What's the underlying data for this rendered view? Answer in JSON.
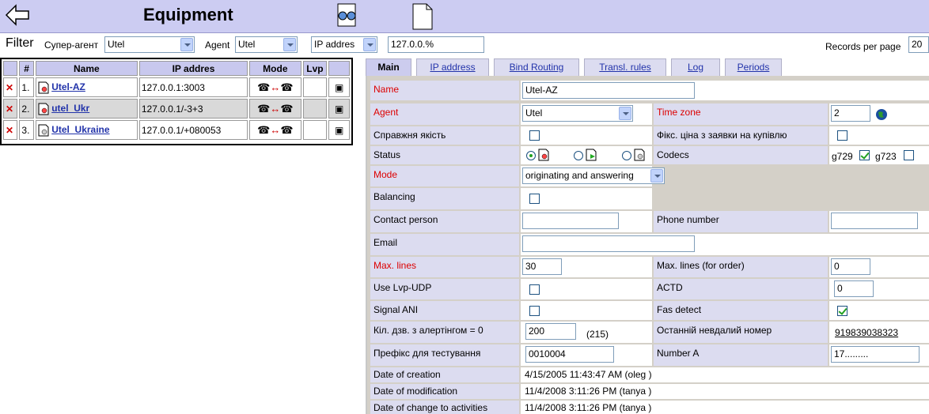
{
  "page": {
    "title": "Equipment"
  },
  "filter": {
    "title": "Filter",
    "super_agent_label": "Супер-агент",
    "super_agent_value": "Utel",
    "agent_label": "Agent",
    "agent_value": "Utel",
    "field_select": "IP addres",
    "search_value": "127.0.0.%",
    "records_label": "Records per page",
    "records_value": "20"
  },
  "grid": {
    "columns": [
      "#",
      "Name",
      "IP addres",
      "Mode",
      "Lvp"
    ],
    "rows": [
      {
        "num": "1.",
        "name": "Utel-AZ",
        "ip": "127.0.0.1:3003"
      },
      {
        "num": "2.",
        "name": "utel_Ukr",
        "ip": "127.0.0.1/-3+3"
      },
      {
        "num": "3.",
        "name": "Utel_Ukraine",
        "ip": "127.0.0.1/+080053"
      }
    ]
  },
  "tabs": [
    "Main",
    "IP address",
    "Bind Routing",
    "Transl. rules",
    "Log",
    "Periods"
  ],
  "form": {
    "name_label": "Name",
    "name_value": "Utel-AZ",
    "agent_label": "Agent",
    "agent_value": "Utel",
    "timezone_label": "Time zone",
    "timezone_value": "2",
    "real_quality_label": "Справжня якість",
    "fixed_price_label": "Фікс. ціна з заявки на купівлю",
    "status_label": "Status",
    "codecs_label": "Codecs",
    "codec1": "g729",
    "codec2": "g723",
    "mode_label": "Mode",
    "mode_value": "originating and answering",
    "balancing_label": "Balancing",
    "contact_label": "Contact person",
    "phone_label": "Phone number",
    "email_label": "Email",
    "maxlines_label": "Max. lines",
    "maxlines_value": "30",
    "maxlines_order_label": "Max. lines (for order)",
    "maxlines_order_value": "0",
    "lvp_udp_label": "Use Lvp-UDP",
    "actd_label": "ACTD",
    "actd_value": "0",
    "signal_ani_label": "Signal ANI",
    "fas_label": "Fas detect",
    "calls_label": "Кіл. дзв. з алертінгом = 0",
    "calls_value": "200",
    "calls_extra": "(215)",
    "last_failed_label": "Останній невдалий номер",
    "last_failed_value": "919839038323",
    "test_prefix_label": "Префікс для тестування",
    "test_prefix_value": "0010004",
    "number_a_label": "Number A",
    "number_a_value": "17.........",
    "created_label": "Date of creation",
    "created_value": "4/15/2005 11:43:47 AM (oleg )",
    "modified_label": "Date of modification",
    "modified_value": "11/4/2008 3:11:26 PM (tanya )",
    "activity_label": "Date of change to activities",
    "activity_value": "11/4/2008 3:11:26 PM (tanya )"
  }
}
